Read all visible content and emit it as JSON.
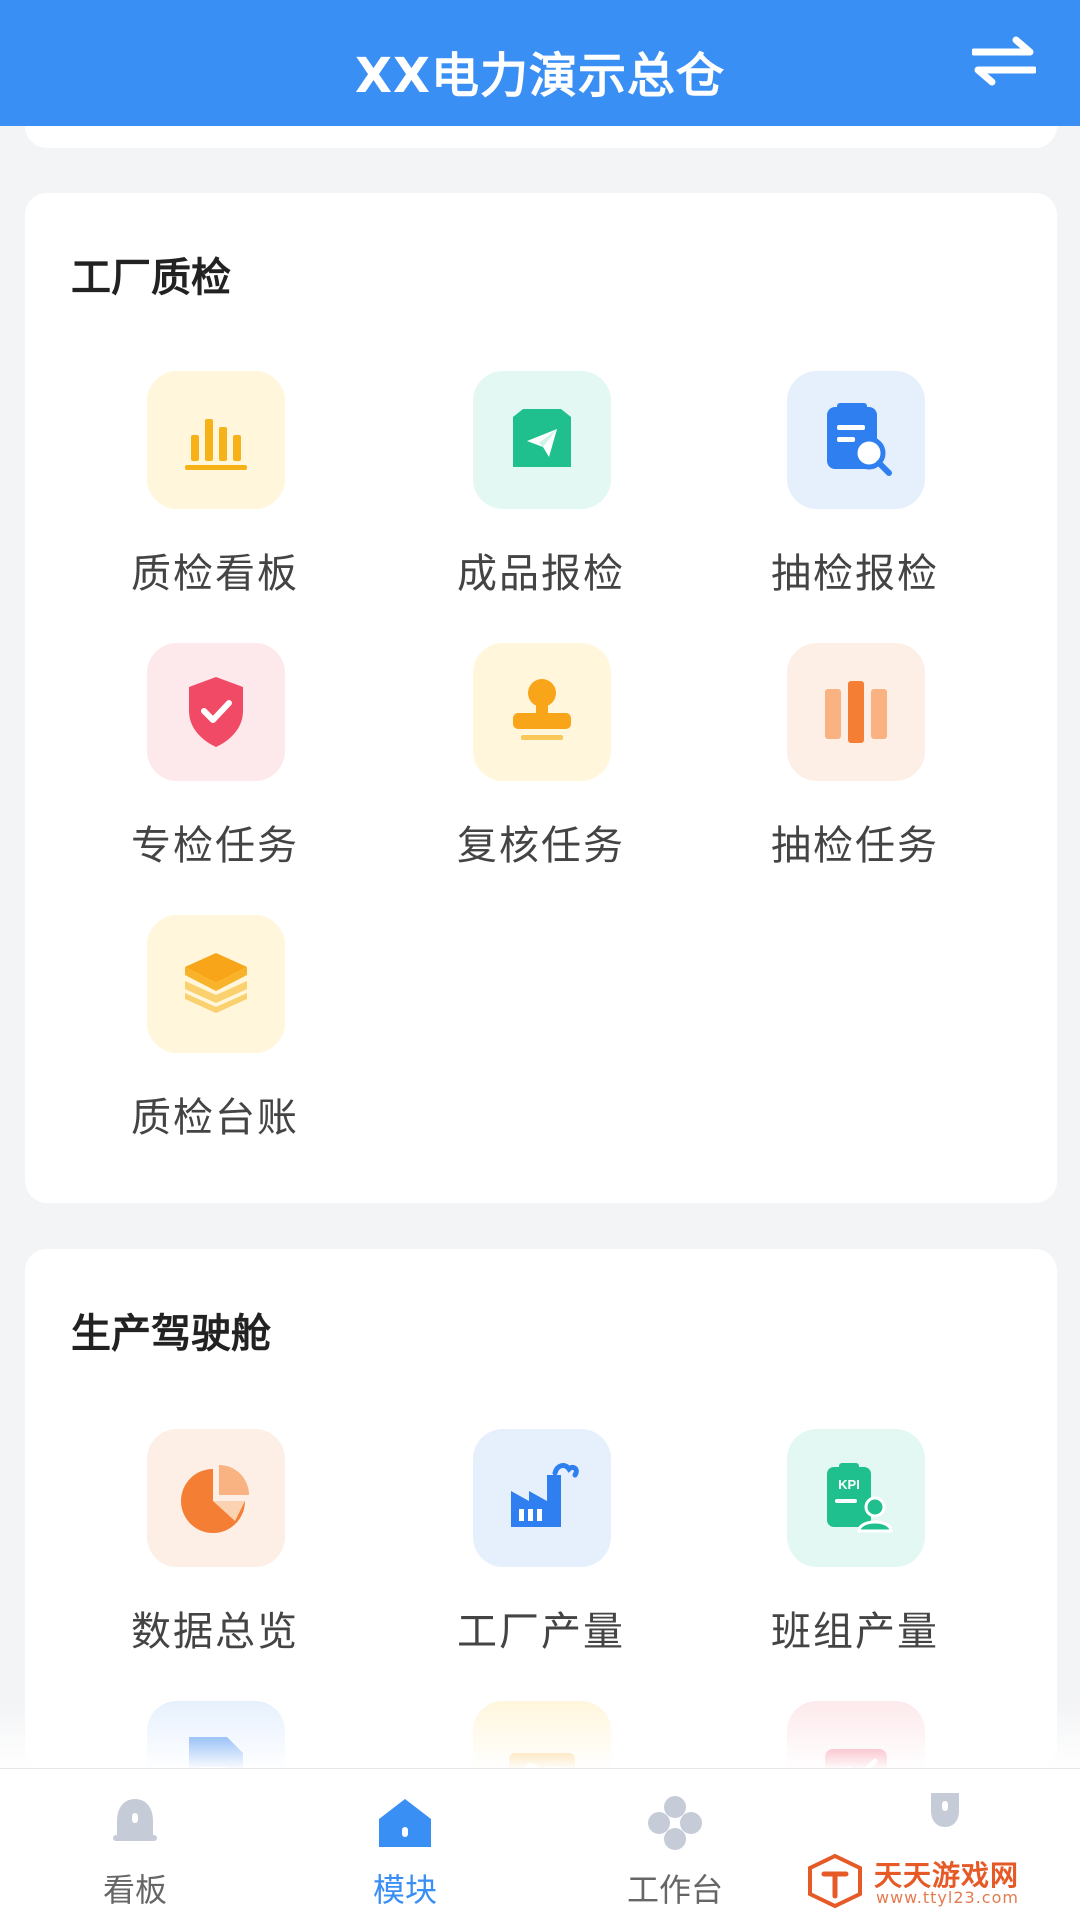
{
  "header": {
    "title": "XX电力演示总仓",
    "switch_icon": "switch-arrows-icon"
  },
  "colors": {
    "header": "#3a8ff5",
    "active_tab": "#3a8ff5",
    "page_bg": "#f3f4f6"
  },
  "sections": [
    {
      "title": "工厂质检",
      "items": [
        {
          "label": "质检看板",
          "icon": "bar-chart-icon"
        },
        {
          "label": "成品报检",
          "icon": "paper-plane-icon"
        },
        {
          "label": "抽检报检",
          "icon": "search-document-icon"
        },
        {
          "label": "专检任务",
          "icon": "shield-check-icon"
        },
        {
          "label": "复核任务",
          "icon": "stamp-icon"
        },
        {
          "label": "抽检任务",
          "icon": "columns-icon"
        },
        {
          "label": "质检台账",
          "icon": "layers-icon"
        }
      ]
    },
    {
      "title": "生产驾驶舱",
      "items": [
        {
          "label": "数据总览",
          "icon": "pie-chart-icon"
        },
        {
          "label": "工厂产量",
          "icon": "factory-icon"
        },
        {
          "label": "班组产量",
          "icon": "kpi-clipboard-icon"
        },
        {
          "label": "",
          "icon": "document-icon"
        },
        {
          "label": "",
          "icon": "card-icon"
        },
        {
          "label": "",
          "icon": "chart-up-icon"
        }
      ]
    }
  ],
  "tabbar": {
    "tabs": [
      {
        "label": "看板",
        "icon": "bell-icon"
      },
      {
        "label": "模块",
        "icon": "home-icon",
        "active": true
      },
      {
        "label": "工作台",
        "icon": "clover-icon"
      },
      {
        "label": "",
        "icon": "profile-icon"
      }
    ]
  },
  "watermark": {
    "text": "天天游戏网",
    "url": "www.ttyl23.com"
  }
}
